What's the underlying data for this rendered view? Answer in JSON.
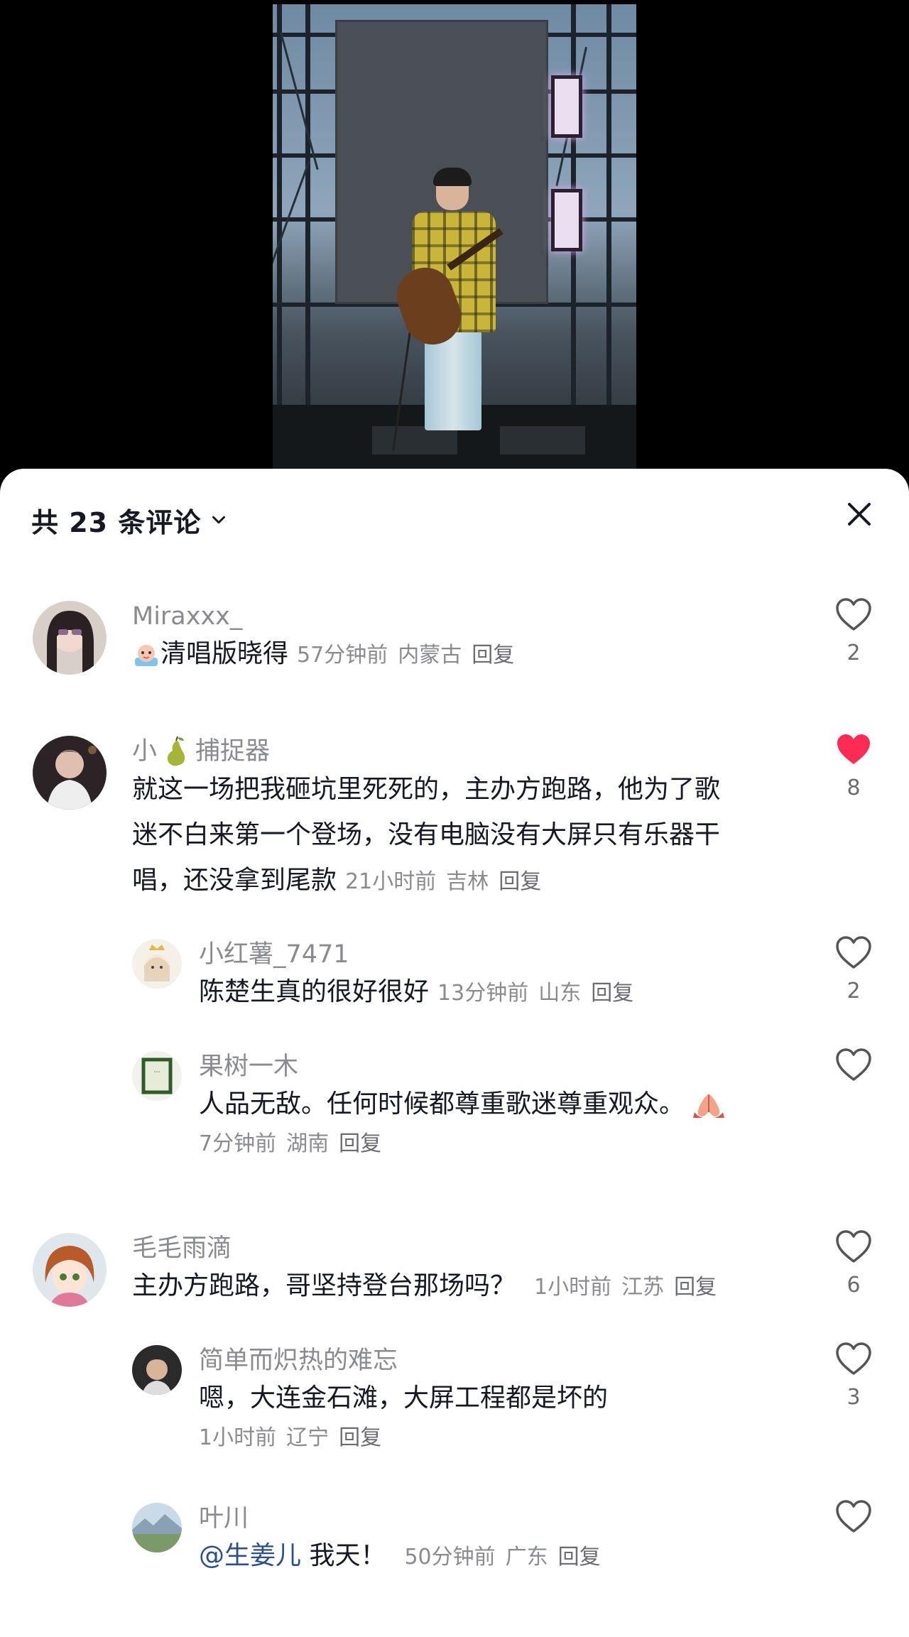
{
  "header": {
    "title": "共 23 条评论"
  },
  "comments": [
    {
      "username": "Miraxxx_",
      "text": "清唱版晓得",
      "time": "57分钟前",
      "location": "内蒙古",
      "reply_label": "回复",
      "likes": "2",
      "liked": false
    },
    {
      "username_prefix": "小",
      "username_suffix": "捕捉器",
      "text_line1": "就这一场把我砸坑里死死的，主办方跑路，他为了歌",
      "text_line2": "迷不白来第一个登场，没有电脑没有大屏只有乐器干",
      "text_line3": "唱，还没拿到尾款",
      "time": "21小时前",
      "location": "吉林",
      "reply_label": "回复",
      "likes": "8",
      "liked": true,
      "like_color": "#fe2c55"
    },
    {
      "username": "小红薯_7471",
      "text": "陈楚生真的很好很好",
      "time": "13分钟前",
      "location": "山东",
      "reply_label": "回复",
      "likes": "2"
    },
    {
      "username": "果树一木",
      "text": "人品无敌。任何时候都尊重歌迷尊重观众。",
      "time": "7分钟前",
      "location": "湖南",
      "reply_label": "回复",
      "likes": ""
    },
    {
      "username": "毛毛雨滴",
      "text": "主办方跑路，哥坚持登台那场吗？",
      "time": "1小时前",
      "location": "江苏",
      "reply_label": "回复",
      "likes": "6"
    },
    {
      "username": "简单而炽热的难忘",
      "text": "嗯，大连金石滩，大屏工程都是坏的",
      "time": "1小时前",
      "location": "辽宁",
      "reply_label": "回复",
      "likes": "3"
    },
    {
      "username": "叶川",
      "mention": "@生姜儿",
      "text": " 我天！",
      "time": "50分钟前",
      "location": "广东",
      "reply_label": "回复",
      "likes": ""
    }
  ]
}
